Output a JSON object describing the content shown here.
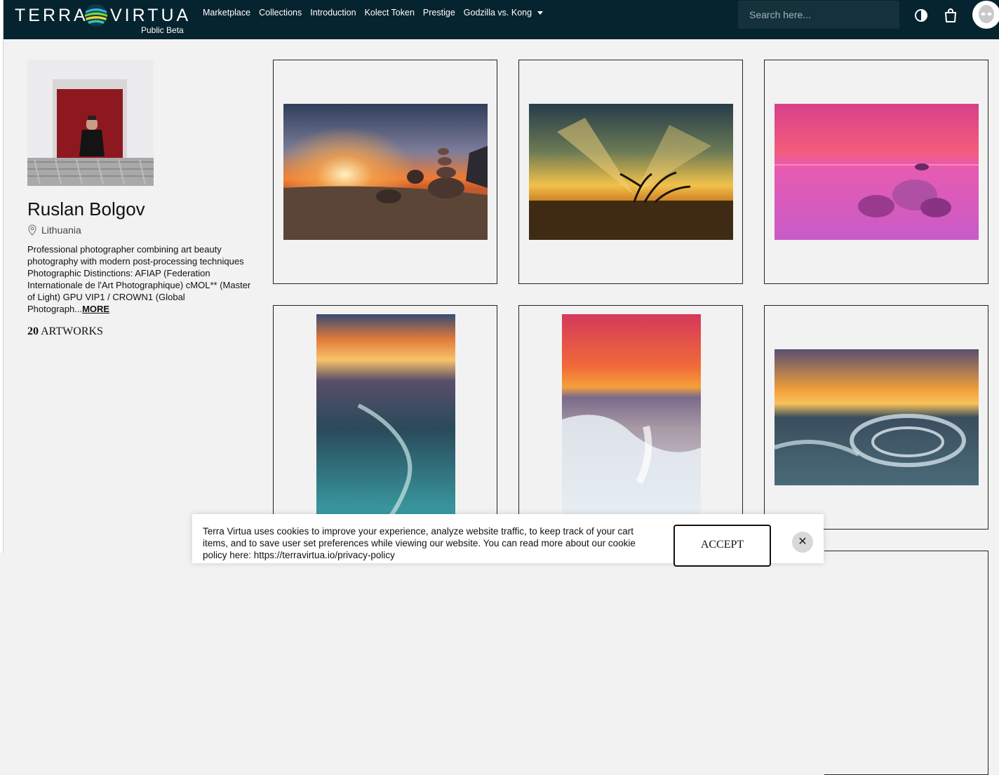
{
  "header": {
    "logo_left": "TERRA",
    "logo_right": "VIRTUA",
    "logo_sub": "Public Beta",
    "nav": [
      {
        "label": "Marketplace"
      },
      {
        "label": "Collections"
      },
      {
        "label": "Introduction"
      },
      {
        "label": "Kolect Token"
      },
      {
        "label": "Prestige"
      },
      {
        "label": "Godzilla vs. Kong"
      }
    ],
    "search_placeholder": "Search here...",
    "icons": [
      "contrast-icon",
      "shopping-bag-icon",
      "avatar-alien-icon"
    ]
  },
  "profile": {
    "name": "Ruslan Bolgov",
    "location": "Lithuania",
    "bio": "Professional photographer combining art beauty photography with modern post-processing techniques Photographic Distinctions: AFIAP (Federation Internationale de l'Art Photographique) cMOL** (Master of Light) GPU VIP1 / CROWN1 (Global Photograph...",
    "bio_more": "MORE",
    "artworks_count": "20",
    "artworks_label": "ARTWORKS"
  },
  "artworks": [
    {
      "theme": "sunset-beach-stone-stacks"
    },
    {
      "theme": "golden-sunset-tree"
    },
    {
      "theme": "pink-sea-rocks"
    },
    {
      "theme": "teal-sand-sunset"
    },
    {
      "theme": "red-sky-icy-shore"
    },
    {
      "theme": "icy-shore-sunset"
    }
  ],
  "cookie": {
    "text": "Terra Virtua uses cookies to improve your experience, analyze website traffic, to keep track of your cart items, and to save user set preferences while viewing our website. You can read more about our cookie policy here: https://terravirtua.io/privacy-policy",
    "accept_label": "ACCEPT",
    "close_label": "✕"
  },
  "colors": {
    "header_bg": "#06242f",
    "page_bg": "#f2f2f2"
  }
}
